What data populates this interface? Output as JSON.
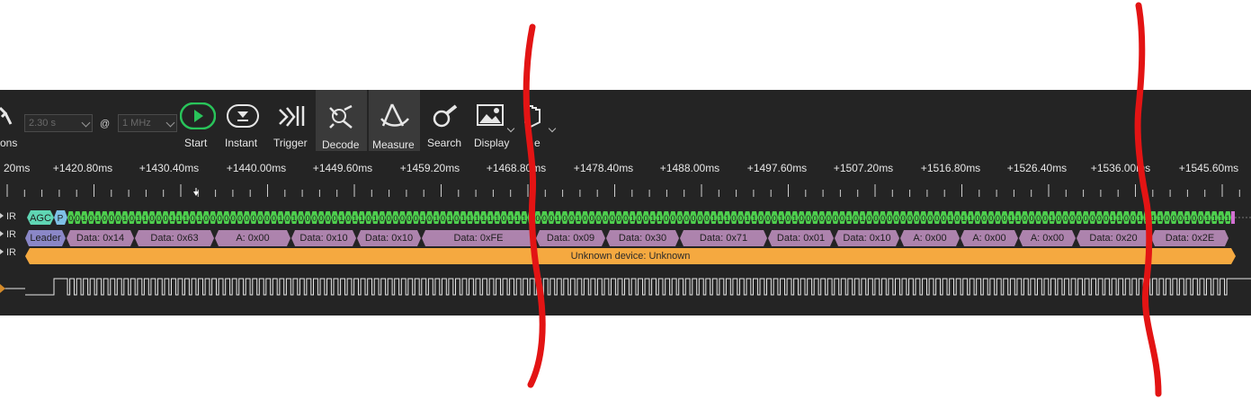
{
  "toolbar": {
    "options_label": "ons",
    "duration_value": "2.30 s",
    "at_symbol": "@",
    "rate_value": "1 MHz",
    "start_label": "Start",
    "instant_label": "Instant",
    "trigger_label": "Trigger",
    "decode_label": "Decode",
    "measure_label": "Measure",
    "search_label": "Search",
    "display_label": "Display",
    "last_label": "e",
    "icons": [
      "wrench-icon",
      "play-icon",
      "instant-icon",
      "trigger-icon",
      "decode-icon",
      "measure-icon",
      "search-icon",
      "display-icon",
      "hand-icon"
    ]
  },
  "time_axis": {
    "ticks": [
      "20ms",
      "+1420.80ms",
      "+1430.40ms",
      "+1440.00ms",
      "+1449.60ms",
      "+1459.20ms",
      "+1468.80ms",
      "+1478.40ms",
      "+1488.00ms",
      "+1497.60ms",
      "+1507.20ms",
      "+1516.80ms",
      "+1526.40ms",
      "+1536.00ms",
      "+1545.60ms"
    ]
  },
  "channels": {
    "row1_name": "IR",
    "row2_name": "IR",
    "row3_name": "IR",
    "agc_label": "AGC",
    "p_label": "P",
    "bits": "0010100010110001110100000000000101000000101101000000101010111111011110001001000000010011000000011100110001010000000101000000000000101100000110000100000000110011110001001111"
  },
  "decoded": [
    {
      "label": "Leader",
      "kind": "leader"
    },
    {
      "label": "Data: 0x14",
      "kind": "data"
    },
    {
      "label": "Data: 0x63",
      "kind": "data"
    },
    {
      "label": "A: 0x00",
      "kind": "data"
    },
    {
      "label": "Data: 0x10",
      "kind": "data"
    },
    {
      "label": "Data: 0x10",
      "kind": "data"
    },
    {
      "label": "Data: 0xFE",
      "kind": "data"
    },
    {
      "label": "Data: 0x09",
      "kind": "data"
    },
    {
      "label": "Data: 0x30",
      "kind": "data"
    },
    {
      "label": "Data: 0x71",
      "kind": "data"
    },
    {
      "label": "Data: 0x01",
      "kind": "data"
    },
    {
      "label": "Data: 0x10",
      "kind": "data"
    },
    {
      "label": "A: 0x00",
      "kind": "data"
    },
    {
      "label": "A: 0x00",
      "kind": "data"
    },
    {
      "label": "A: 0x00",
      "kind": "data"
    },
    {
      "label": "Data: 0x20",
      "kind": "data"
    },
    {
      "label": "Data: 0x2E",
      "kind": "data"
    }
  ],
  "device_label": "Unknown device: Unknown",
  "colors": {
    "app_bg": "#242424",
    "bit_green": "#4ecf4e",
    "agc_teal": "#5fd6b4",
    "data_purple": "#ad83ad",
    "leader_blue": "#8a87c7",
    "device_orange": "#f5a940",
    "annotation_red": "#e31414",
    "start_green": "#29c45a"
  }
}
